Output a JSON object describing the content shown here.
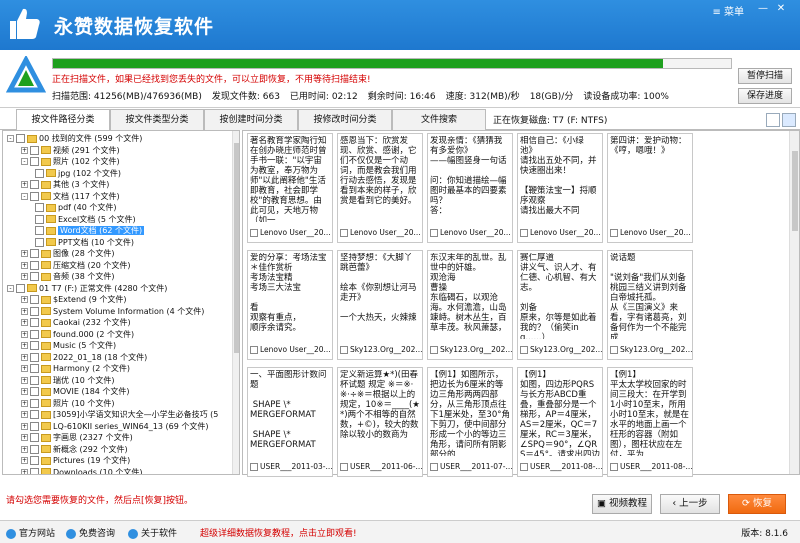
{
  "app": {
    "title": "永赞数据恢复软件",
    "menu_label": "菜单",
    "colors": {
      "brand": "#1e78cf",
      "progress": "#1ea01e",
      "alert": "#d40000",
      "accent": "#f06a10"
    }
  },
  "scan": {
    "notice": "正在扫描文件，如果已经找到您丢失的文件，可以立即恢复，不用等待扫描结束!",
    "progress": 0.9,
    "stats": [
      "扫描范围: 41256(MB)/476936(MB)",
      "发现文件数: 663",
      "已用时间: 02:12",
      "剩余时间: 16:46",
      "速度: 312(MB)/秒",
      "18(GB)/分",
      "读设备成功率: 100%"
    ],
    "pause_label": "暂停扫描",
    "save_label": "保存进度"
  },
  "tabs": [
    "按文件路径分类",
    "按文件类型分类",
    "按创建时间分类",
    "按修改时间分类",
    "文件搜索"
  ],
  "disk_label": "正在恢复磁盘: T7 (F: NTFS)",
  "tree": [
    {
      "label": "00 找到的文件  (599 个文件)",
      "level": 0,
      "exp": "-",
      "chk": true
    },
    {
      "label": "视频  (291 个文件)",
      "level": 1,
      "exp": "+",
      "chk": true
    },
    {
      "label": "照片  (102 个文件)",
      "level": 1,
      "exp": "-",
      "chk": true
    },
    {
      "label": "jpg  (102 个文件)",
      "level": 2,
      "exp": "",
      "chk": true
    },
    {
      "label": "其他  (3 个文件)",
      "level": 1,
      "exp": "+",
      "chk": true
    },
    {
      "label": "文档  (117 个文件)",
      "level": 1,
      "exp": "-",
      "chk": true
    },
    {
      "label": "pdf  (40 个文件)",
      "level": 2,
      "exp": "",
      "chk": true
    },
    {
      "label": "Excel文档  (5 个文件)",
      "level": 2,
      "exp": "",
      "chk": true
    },
    {
      "label": "Word文档  (62 个文件)",
      "level": 2,
      "exp": "",
      "chk": true,
      "sel": true
    },
    {
      "label": "PPT文档  (10 个文件)",
      "level": 2,
      "exp": "",
      "chk": true
    },
    {
      "label": "图像  (28 个文件)",
      "level": 1,
      "exp": "+",
      "chk": true
    },
    {
      "label": "压缩文档  (20 个文件)",
      "level": 1,
      "exp": "+",
      "chk": true
    },
    {
      "label": "音频  (38 个文件)",
      "level": 1,
      "exp": "+",
      "chk": true
    },
    {
      "label": "01 T7 (F:) 正常文件  (4280 个文件)",
      "level": 0,
      "exp": "-",
      "chk": true
    },
    {
      "label": "$Extend  (9 个文件)",
      "level": 1,
      "exp": "+",
      "chk": true
    },
    {
      "label": "System Volume Information  (4 个文件)",
      "level": 1,
      "exp": "+",
      "chk": true
    },
    {
      "label": "Caokai  (232 个文件)",
      "level": 1,
      "exp": "+",
      "chk": true
    },
    {
      "label": "found.000  (2 个文件)",
      "level": 1,
      "exp": "+",
      "chk": true
    },
    {
      "label": "Music  (5 个文件)",
      "level": 1,
      "exp": "+",
      "chk": true
    },
    {
      "label": "2022_01_18  (18 个文件)",
      "level": 1,
      "exp": "+",
      "chk": true
    },
    {
      "label": "Harmony  (2 个文件)",
      "level": 1,
      "exp": "+",
      "chk": true
    },
    {
      "label": "瑞优  (10 个文件)",
      "level": 1,
      "exp": "+",
      "chk": true
    },
    {
      "label": "MOVIE  (184 个文件)",
      "level": 1,
      "exp": "+",
      "chk": true
    },
    {
      "label": "照片  (10 个文件)",
      "level": 1,
      "exp": "+",
      "chk": true
    },
    {
      "label": "[3059]小学语文知识大全—小学生必备技巧  (5",
      "level": 1,
      "exp": "+",
      "chk": true
    },
    {
      "label": "LQ-610KII series_WIN64_13  (69 个文件)",
      "level": 1,
      "exp": "+",
      "chk": true
    },
    {
      "label": "字画思  (2327 个文件)",
      "level": 1,
      "exp": "+",
      "chk": true
    },
    {
      "label": "新概念  (292 个文件)",
      "level": 1,
      "exp": "+",
      "chk": true
    },
    {
      "label": "Pictures  (19 个文件)",
      "level": 1,
      "exp": "+",
      "chk": true
    },
    {
      "label": "Downloads  (10 个文件)",
      "level": 1,
      "exp": "+",
      "chk": true
    }
  ],
  "cards": [
    {
      "text": "著名教育学家陶行知在创办晓庄师范时曾手书一联：\"以宇宙为教室，奉万物为师\"以此阐释他\"生活即教育，社会即学校\"的教育思想。由此可见，天地万物（如一",
      "foot": "Lenovo User__20..."
    },
    {
      "text": "感恩当下：欣赏发现、欣赏、感谢，它们不仅仅是一个动词，而是教会我们用行动去感悟，发现是看到本来的样子，欣赏是看到它的美好。",
      "foot": "Lenovo User__20..."
    },
    {
      "text": "发现亲情：《猜猜我有多爱你》\n——幅图竖身一句话\n\n问：你知道描绘—幅图时最基本的四要素吗？\n答：",
      "foot": "Lenovo User__20..."
    },
    {
      "text": "相信自己：《小绿池》\n请找出五处不同，并快速圈出来！\n\n【鞭策法宝一】捋顺序观察\n请找出最大不同",
      "foot": "Lenovo User__20..."
    },
    {
      "text": "第四讲：爱护动物：《哼，嗯哦！》",
      "foot": "Lenovo User__20..."
    },
    {
      "text": "爱的分享：考场法宝＊佳作赏析\n考场法宝精\n考场三大法宝\n\n看\n观察有重点，\n顺序余请究。",
      "foot": "Lenovo User__20..."
    },
    {
      "text": "坚持梦想：《大脚丫跳芭蕾》\n\n绘本《你别想让河马走开》\n\n一个大热天，火辣辣",
      "foot": "Sky123.Org__202..."
    },
    {
      "text": "东汉末年的乱世。乱世中的奸雄。\n观沧海\n曹操\n东临碣石，以观沧海。水何澹澹，山岛竦峙。树木丛生，百草丰茂。秋风萧瑟，",
      "foot": "Sky123.Org__202..."
    },
    {
      "text": "赛仁厚道\n讲义气、识人才、有仁德、心机智、有大志。\n\n刘备\n原来，尔等是如此着我的？（偷笑ing......）",
      "foot": "Sky123.Org__202..."
    },
    {
      "text": "说话题\n\n\"说刘备\"我们从刘备桃园三结义讲到刘备白帝城托孤。\n从《三国演义》来看，字有诸葛亮，刘备何作为一个不能完成",
      "foot": "Sky123.Org__202..."
    },
    {
      "text": "一、平面图形计数问题\n\n SHAPE \\*\nMERGEFORMAT\n\n SHAPE \\*\nMERGEFORMAT",
      "foot": "USER___2011-03-..."
    },
    {
      "text": "定义新运算★*)(田春杯试题 规定 ※＝※·※·÷※＝根据以上的规定，10※＝____(★*)两个不相等的自然数，+©)，较大的数除以较小的数商为",
      "foot": "USER___2011-06-..."
    },
    {
      "text": "【例1】如图所示，把边长为6厘米的等边三角形两两四部分，从三角形顶点往下1厘米处，至30°角下剪刀，使中间部分形成一个小的等边三角形，请问所有阴影部分的",
      "foot": "USER___2011-07-..."
    },
    {
      "text": "【例1】\n如图，四边形PQRS与长方形ABCD重叠，重叠部分是一个梯形，AP＝4厘米，AS＝2厘米，QC＝7厘米，RC＝3厘米，∠SPQ＝90°，∠QRS＝45°。请求出四边形PQRS的",
      "foot": "USER___2011-08-..."
    },
    {
      "text": "【例1】\n平太太学校回家的时间三段大：在开学到1小时10至末，所用 小时10至末，就是在水平的地面上画一个枉形的容器（附如图），图枉状应在左付，平为",
      "foot": "USER___2011-08-..."
    }
  ],
  "bottom": {
    "hint": "请勾选您需要恢复的文件，然后点[恢复]按钮。",
    "video_label": "视频教程",
    "prev_label": "上一步",
    "recover_label": "恢复"
  },
  "statusbar": {
    "links": [
      "官方网站",
      "免费咨询",
      "关于软件"
    ],
    "promo": "超级详细数据恢复教程，点击立即观看!",
    "version": "版本: 8.1.6"
  }
}
